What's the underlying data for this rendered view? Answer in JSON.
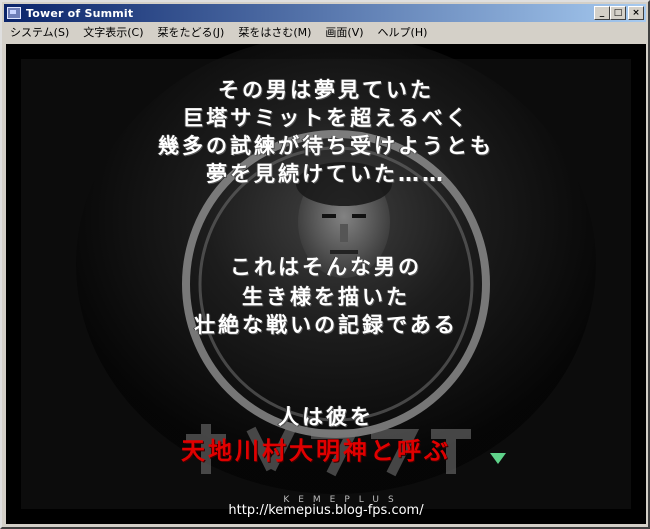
{
  "window": {
    "title": "Tower of Summit",
    "minimize_glyph": "_",
    "maximize_glyph": "□",
    "close_glyph": "×"
  },
  "menu": [
    {
      "label": "システム(S)"
    },
    {
      "label": "文字表示(C)"
    },
    {
      "label": "栞をたどる(J)"
    },
    {
      "label": "栞をはさむ(M)"
    },
    {
      "label": "画面(V)"
    },
    {
      "label": "ヘルプ(H)"
    }
  ],
  "story": {
    "lines": [
      "その男は夢見ていた",
      "巨塔サミットを超えるべく",
      "幾多の試練が待ち受けようとも",
      "夢を見続けていた……",
      "これはそんな男の",
      "生き様を描いた",
      "壮絶な戦いの記録である",
      "人は彼を"
    ],
    "highlight_line": "天地川村大明神と呼ぶ",
    "wait_indicator_icon": "green-triangle-down-icon",
    "highlight_color": "#e00000"
  },
  "background": {
    "logo_text": "KEMEPLUS",
    "url": "http://kemepius.blog-fps.com/"
  }
}
